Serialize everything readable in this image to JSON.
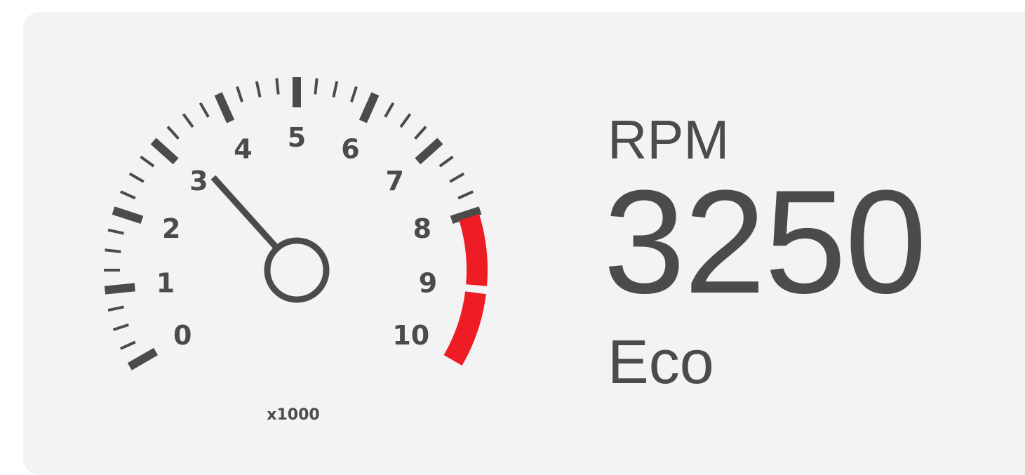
{
  "gauge": {
    "min": 0,
    "max": 10,
    "labels": [
      "0",
      "1",
      "2",
      "3",
      "4",
      "5",
      "6",
      "7",
      "8",
      "9",
      "10"
    ],
    "unit": "x1000",
    "redline_start": 8,
    "needle_value": 3.25,
    "colors": {
      "ticks": "#4b4b4b",
      "redline": "#ee1c25",
      "background": "#f3f3f3"
    }
  },
  "readout": {
    "label": "RPM",
    "value": "3250",
    "mode": "Eco"
  }
}
